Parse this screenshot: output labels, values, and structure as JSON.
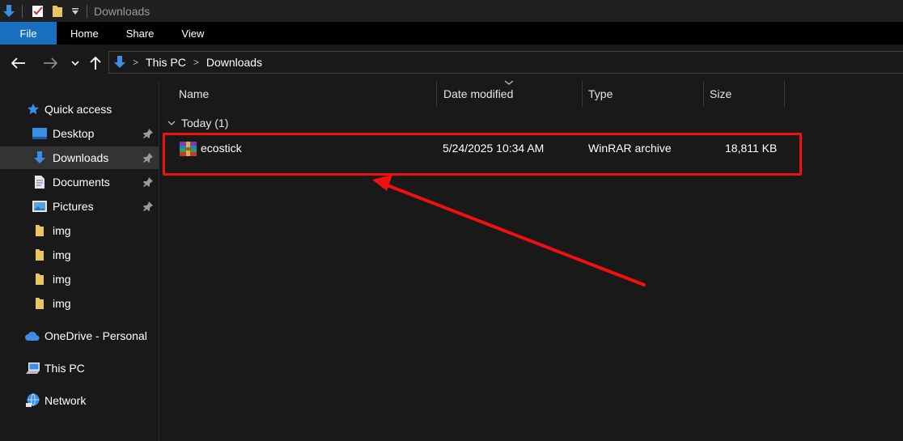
{
  "window": {
    "title": "Downloads"
  },
  "ribbon": {
    "tabs": [
      "File",
      "Home",
      "Share",
      "View"
    ]
  },
  "address": {
    "crumbs": [
      "This PC",
      "Downloads"
    ]
  },
  "sidebar": {
    "quick_access": "Quick access",
    "items": [
      {
        "label": "Desktop",
        "pinned": true
      },
      {
        "label": "Downloads",
        "pinned": true,
        "selected": true
      },
      {
        "label": "Documents",
        "pinned": true
      },
      {
        "label": "Pictures",
        "pinned": true
      },
      {
        "label": "img"
      },
      {
        "label": "img"
      },
      {
        "label": "img"
      },
      {
        "label": "img"
      }
    ],
    "onedrive": "OneDrive - Personal",
    "this_pc": "This PC",
    "network": "Network"
  },
  "columns": {
    "name": "Name",
    "date": "Date modified",
    "type": "Type",
    "size": "Size"
  },
  "group": {
    "label": "Today (1)"
  },
  "files": [
    {
      "name": "ecostick",
      "date": "5/24/2025 10:34 AM",
      "type": "WinRAR archive",
      "size": "18,811 KB"
    }
  ],
  "colors": {
    "accent": "#1a6fc1",
    "annotation": "#f01010",
    "folder": "#e8c463"
  }
}
